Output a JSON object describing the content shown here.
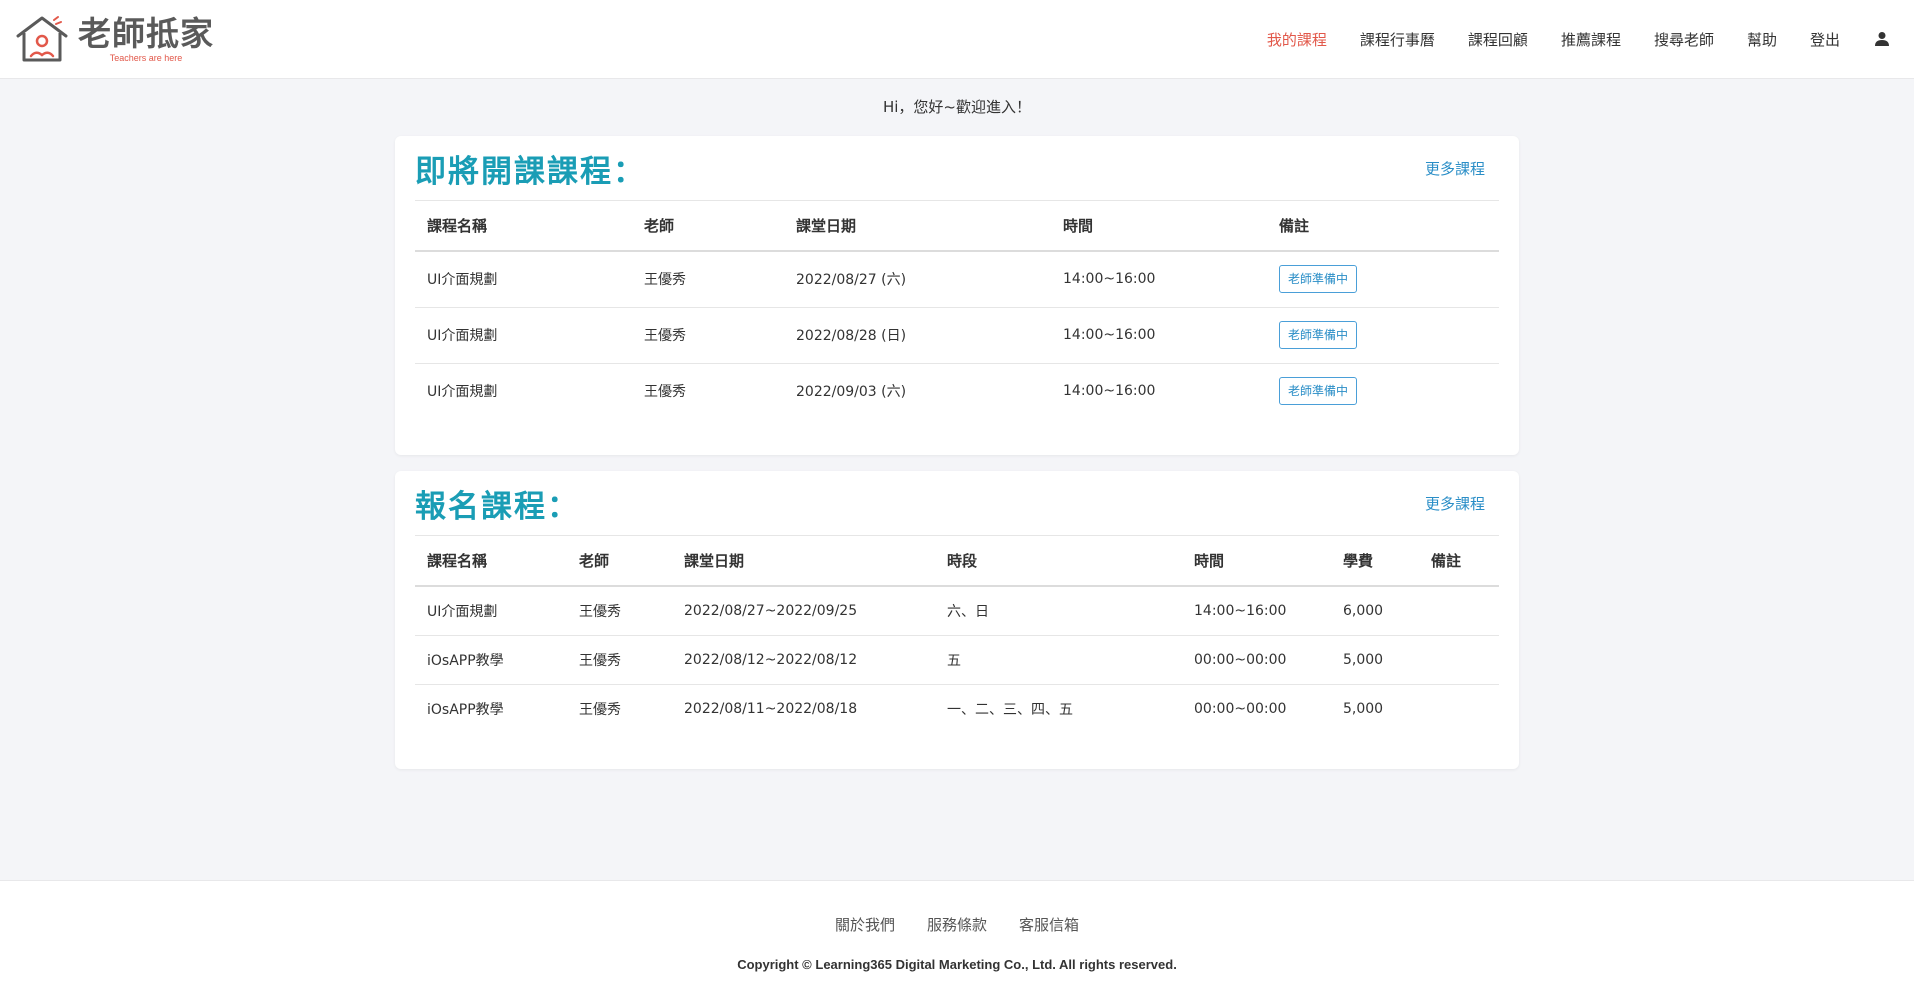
{
  "brand": {
    "name": "老師抵家",
    "tagline": "Teachers are here",
    "accent": "#e2584a"
  },
  "nav": {
    "items": [
      {
        "label": "我的課程",
        "active": true
      },
      {
        "label": "課程行事曆",
        "active": false
      },
      {
        "label": "課程回顧",
        "active": false
      },
      {
        "label": "推薦課程",
        "active": false
      },
      {
        "label": "搜尋老師",
        "active": false
      },
      {
        "label": "幫助",
        "active": false
      },
      {
        "label": "登出",
        "active": false
      }
    ],
    "user_icon": "user-icon"
  },
  "greeting": "Hi，您好~歡迎進入！",
  "upcoming": {
    "title": "即將開課課程：",
    "more_label": "更多課程",
    "columns": [
      "課程名稱",
      "老師",
      "課堂日期",
      "時間",
      "備註"
    ],
    "rows": [
      {
        "course": "UI介面規劃",
        "teacher": "王優秀",
        "date": "2022/08/27 (六)",
        "time": "14:00~16:00",
        "note": "老師準備中"
      },
      {
        "course": "UI介面規劃",
        "teacher": "王優秀",
        "date": "2022/08/28 (日)",
        "time": "14:00~16:00",
        "note": "老師準備中"
      },
      {
        "course": "UI介面規劃",
        "teacher": "王優秀",
        "date": "2022/09/03 (六)",
        "time": "14:00~16:00",
        "note": "老師準備中"
      }
    ]
  },
  "enrolled": {
    "title": "報名課程：",
    "more_label": "更多課程",
    "columns": [
      "課程名稱",
      "老師",
      "課堂日期",
      "時段",
      "時間",
      "學費",
      "備註"
    ],
    "rows": [
      {
        "course": "UI介面規劃",
        "teacher": "王優秀",
        "date": "2022/08/27~2022/09/25",
        "days": "六、日",
        "time": "14:00~16:00",
        "fee": "6,000",
        "note": ""
      },
      {
        "course": "iOsAPP教學",
        "teacher": "王優秀",
        "date": "2022/08/12~2022/08/12",
        "days": "五",
        "time": "00:00~00:00",
        "fee": "5,000",
        "note": ""
      },
      {
        "course": "iOsAPP教學",
        "teacher": "王優秀",
        "date": "2022/08/11~2022/08/18",
        "days": "一、二、三、四、五",
        "time": "00:00~00:00",
        "fee": "5,000",
        "note": ""
      }
    ]
  },
  "footer": {
    "links": [
      "關於我們",
      "服務條款",
      "客服信箱"
    ],
    "copyright": "Copyright © Learning365 Digital Marketing Co., Ltd. All rights reserved."
  }
}
